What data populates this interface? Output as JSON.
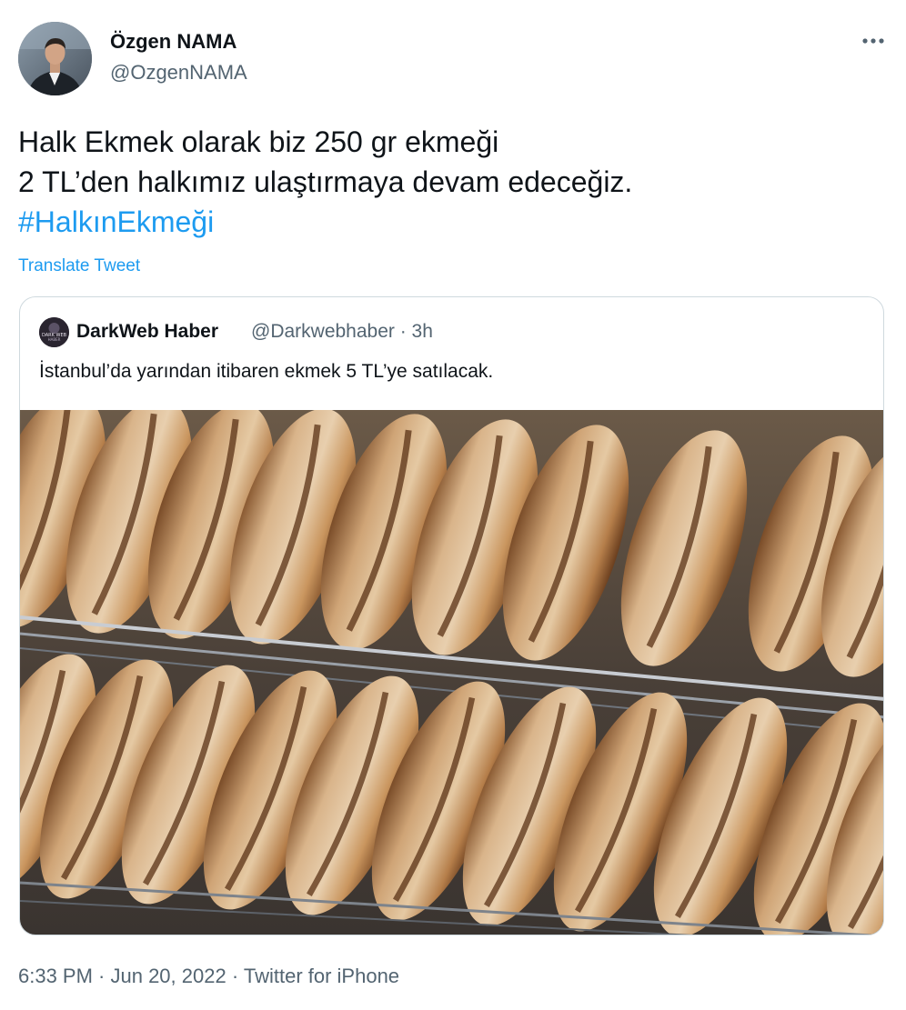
{
  "author": {
    "display_name": "Özgen NAMA",
    "handle": "@OzgenNAMA"
  },
  "tweet": {
    "line1": "Halk Ekmek olarak biz 250 gr ekmeği",
    "line2": "2 TL’den halkımız ulaştırmaya devam edeceğiz.",
    "hashtag": "#HalkınEkmeği",
    "translate_label": "Translate Tweet"
  },
  "quoted_tweet": {
    "avatar_text_1": "DARK WEB",
    "avatar_text_2": "HABER",
    "display_name": "DarkWeb Haber",
    "handle_time": "@Darkwebhaber · 3h",
    "text": "İstanbul’da yarından itibaren ekmek 5 TL’ye satılacak."
  },
  "footer": {
    "time_date": "6:33 PM · Jun 20, 2022 · ",
    "source": "Twitter for iPhone"
  },
  "colors": {
    "link": "#1d9bf0",
    "secondary_text": "#536471",
    "primary_text": "#0f1419",
    "border": "#cfd9de"
  },
  "icons": [
    "more-options-icon"
  ]
}
